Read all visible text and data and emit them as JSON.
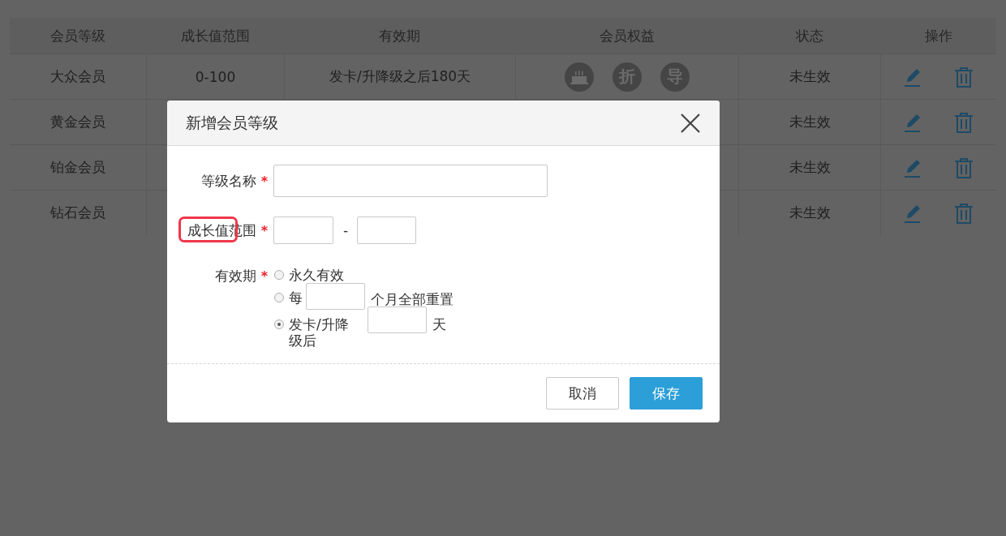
{
  "table": {
    "columns": [
      "会员等级",
      "成长值范围",
      "有效期",
      "会员权益",
      "状态",
      "操作"
    ],
    "rows": [
      {
        "level": "大众会员",
        "range": "0-100",
        "validity": "发卡/升降级之后180天",
        "benefits": [
          {
            "kind": "cake"
          },
          {
            "kind": "text",
            "label": "折"
          },
          {
            "kind": "text",
            "label": "导"
          }
        ],
        "status": "未生效"
      },
      {
        "level": "黄金会员",
        "status": "未生效"
      },
      {
        "level": "铂金会员",
        "status": "未生效"
      },
      {
        "level": "钻石会员",
        "status": "未生效"
      }
    ]
  },
  "dialog": {
    "title": "新增会员等级",
    "fields": [
      {
        "kind": "text",
        "label": "等级名称",
        "required_mark": "*"
      },
      {
        "kind": "range",
        "label": "成长值范围",
        "required_mark": "*",
        "separator": "-",
        "highlighted": true
      },
      {
        "kind": "radios",
        "label": "有效期",
        "required_mark": "*",
        "options": [
          {
            "kind": "plain",
            "label": "永久有效",
            "selected": false
          },
          {
            "kind": "input",
            "label": "每",
            "suffix": "个月全部重置",
            "selected": false
          },
          {
            "kind": "input",
            "label": "发卡/升降级后",
            "suffix": "天",
            "selected": true
          }
        ]
      }
    ],
    "buttons": [
      {
        "kind": "secondary",
        "label": "取消"
      },
      {
        "kind": "primary",
        "label": "保存"
      }
    ]
  }
}
